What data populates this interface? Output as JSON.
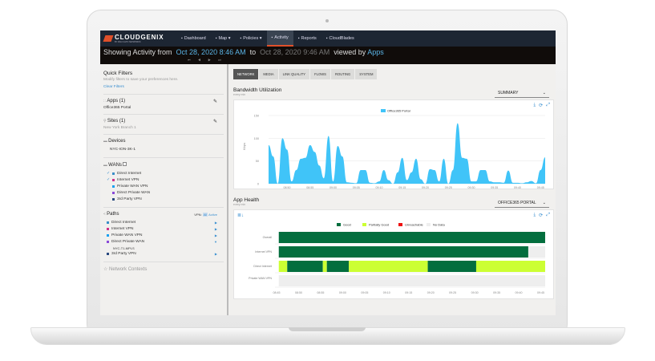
{
  "nav": {
    "brand": "CLOUDGENIX",
    "brand_sub": "BY PALO ALTO NETWORKS",
    "items": [
      {
        "label": "Dashboard",
        "icon": "dashboard-icon"
      },
      {
        "label": "Map ▾",
        "icon": "map-icon"
      },
      {
        "label": "Policies ▾",
        "icon": "shield-icon"
      },
      {
        "label": "Activity",
        "icon": "binoculars-icon",
        "active": true
      },
      {
        "label": "Reports",
        "icon": "report-icon"
      },
      {
        "label": "CloudBlades",
        "icon": "cloudblades-icon"
      }
    ]
  },
  "activity": {
    "prefix": "Showing Activity from",
    "from": "Oct 28, 2020 8:46 AM",
    "to_label": "to",
    "to": "Oct 28, 2020 9:46 AM",
    "viewed_by": "viewed by",
    "view": "Apps",
    "arrows": "⏮ ◀ ▶ ⏭"
  },
  "filters": {
    "title": "Quick Filters",
    "hint": "Modify filters to save your preferences here.",
    "clear": "Clear Filters",
    "apps": {
      "title": "Apps (1)",
      "value": "Office365 Portal"
    },
    "sites": {
      "title": "Sites (1)",
      "value": "New York Branch 1"
    },
    "devices": {
      "title": "Devices",
      "value": "NYC-ION-3K-1"
    },
    "wans": {
      "title": "WANs",
      "items": [
        {
          "label": "Direct Internet",
          "color": "#3a8fc8",
          "checked": true
        },
        {
          "label": "Internet VPN",
          "color": "#d0308a",
          "checked": true
        },
        {
          "label": "Private WAN VPN",
          "color": "#1aa0f0",
          "checked": false
        },
        {
          "label": "Direct Private WAN",
          "color": "#8a4ad8",
          "checked": false
        },
        {
          "label": "3rd Party VPN",
          "color": "#2a4a80",
          "checked": false
        }
      ]
    },
    "paths": {
      "title": "Paths",
      "vpn_label": "VPN:",
      "vpn_all": "All",
      "vpn_active": "Active",
      "items": [
        {
          "label": "Direct Internet",
          "color": "#3a8fc8",
          "chev": "▶"
        },
        {
          "label": "Internet VPN",
          "color": "#d0308a",
          "chev": "▶"
        },
        {
          "label": "Private WAN VPN",
          "color": "#1aa0f0",
          "chev": "▶"
        },
        {
          "label": "Direct Private WAN",
          "color": "#8a4ad8",
          "chev": "▼",
          "sub": "NYC-T1-MPLS"
        },
        {
          "label": "3rd Party VPN",
          "color": "#2a4a80",
          "chev": "▶"
        }
      ]
    },
    "network_contexts": "Network Contexts"
  },
  "tabs": [
    "NETWORK",
    "MEDIA",
    "LINK QUALITY",
    "FLOWS",
    "ROUTING",
    "SYSTEM"
  ],
  "bandwidth": {
    "title": "Bandwidth Utilization",
    "subtitle": "every min",
    "dropdown": "SUMMARY"
  },
  "health": {
    "title": "App Health",
    "subtitle": "every min",
    "dropdown": "OFFICE365 PORTAL"
  },
  "chart_data": [
    {
      "type": "area",
      "ylabel": "Kbps",
      "ylim": [
        0,
        150
      ],
      "yticks": [
        0,
        50,
        100,
        150
      ],
      "grid": true,
      "legend_position": "top-center",
      "x_start": "08:46",
      "x_step_minutes": 1,
      "xticks": [
        "08:50",
        "08:55",
        "09:00",
        "09:05",
        "09:10",
        "09:15",
        "09:20",
        "09:25",
        "09:30",
        "09:35",
        "09:40",
        "09:45"
      ],
      "series": [
        {
          "name": "Office365 Portal",
          "color": "#40c4f8",
          "values": [
            85,
            60,
            0,
            100,
            75,
            5,
            30,
            55,
            57,
            85,
            70,
            40,
            12,
            105,
            5,
            83,
            60,
            3,
            2,
            1,
            30,
            30,
            2,
            1,
            5,
            30,
            8,
            0,
            25,
            57,
            8,
            25,
            55,
            10,
            0,
            32,
            30,
            5,
            55,
            0,
            30,
            133,
            57,
            55,
            5,
            5,
            30,
            30,
            5,
            3,
            3,
            2,
            29,
            2,
            2,
            1,
            3,
            6,
            1,
            30,
            58
          ]
        }
      ]
    },
    {
      "type": "timeline",
      "xlim": [
        "08:45",
        "09:46"
      ],
      "xticks": [
        "08:45",
        "08:50",
        "08:55",
        "09:00",
        "09:05",
        "09:10",
        "09:15",
        "09:20",
        "09:25",
        "09:30",
        "09:35",
        "09:40",
        "09:45"
      ],
      "legend": [
        {
          "name": "Good",
          "color": "#036e3e"
        },
        {
          "name": "Partially Good",
          "color": "#ccff33"
        },
        {
          "name": "Unreachable",
          "color": "#ee1111"
        },
        {
          "name": "No Data",
          "color": "#eeeeee"
        }
      ],
      "rows": [
        {
          "label": "Overall",
          "segments": [
            [
              "08:45:30",
              "09:46:00",
              "Good"
            ]
          ]
        },
        {
          "label": "Internet VPN",
          "segments": [
            [
              "08:45:30",
              "09:42:10",
              "Good"
            ],
            [
              "09:42:10",
              "09:46:00",
              "No Data"
            ]
          ]
        },
        {
          "label": "Direct Internet",
          "segments": [
            [
              "08:45:30",
              "08:47:25",
              "Partially Good"
            ],
            [
              "08:47:25",
              "08:55:30",
              "Good"
            ],
            [
              "08:55:30",
              "08:56:25",
              "Partially Good"
            ],
            [
              "08:56:25",
              "09:01:25",
              "Good"
            ],
            [
              "09:01:25",
              "09:19:20",
              "Partially Good"
            ],
            [
              "09:19:20",
              "09:30:20",
              "Good"
            ],
            [
              "09:30:20",
              "09:46:00",
              "Partially Good"
            ]
          ]
        },
        {
          "label": "Private WAN VPN",
          "segments": [
            [
              "08:45:30",
              "09:46:00",
              "No Data"
            ]
          ]
        }
      ]
    }
  ]
}
